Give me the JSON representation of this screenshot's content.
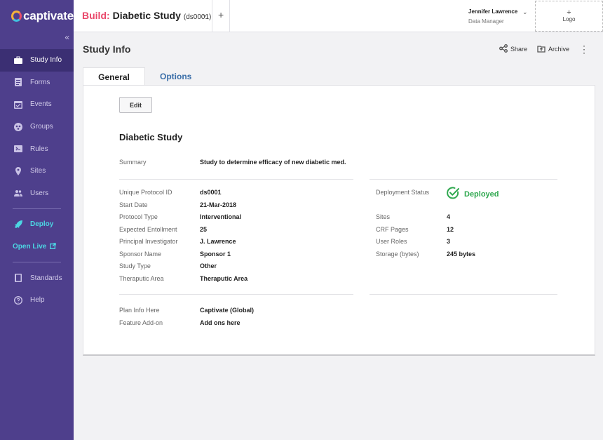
{
  "brand": {
    "name": "captivate"
  },
  "header": {
    "build_label": "Build:",
    "study_title": "Diabetic Study",
    "study_id": "(ds0001)",
    "user_name": "Jennifer Lawrence",
    "user_role": "Data Manager",
    "logo_plus": "+",
    "logo_label": "Logo"
  },
  "sidebar": {
    "collapse": "«",
    "items": [
      {
        "label": "Study Info",
        "icon": "briefcase-icon"
      },
      {
        "label": "Forms",
        "icon": "forms-icon"
      },
      {
        "label": "Events",
        "icon": "calendar-icon"
      },
      {
        "label": "Groups",
        "icon": "groups-icon"
      },
      {
        "label": "Rules",
        "icon": "rules-icon"
      },
      {
        "label": "Sites",
        "icon": "location-pin-icon"
      },
      {
        "label": "Users",
        "icon": "users-icon"
      }
    ],
    "deploy": "Deploy",
    "open_live": "Open Live",
    "standards": "Standards",
    "help": "Help"
  },
  "page": {
    "title": "Study Info",
    "share": "Share",
    "archive": "Archive",
    "tabs": [
      "General",
      "Options"
    ]
  },
  "card": {
    "edit": "Edit",
    "study_name": "Diabetic Study",
    "summary_label": "Summary",
    "summary_value": "Study to determine efficacy of new diabetic med.",
    "details": [
      {
        "label": "Unique Protocol ID",
        "value": "ds0001"
      },
      {
        "label": "Start Date",
        "value": "21-Mar-2018"
      },
      {
        "label": "Protocol Type",
        "value": "Interventional"
      },
      {
        "label": "Expected Entollment",
        "value": "25"
      },
      {
        "label": "Principal Investigator",
        "value": "J. Lawrence"
      },
      {
        "label": "Sponsor Name",
        "value": "Sponsor 1"
      },
      {
        "label": "Study Type",
        "value": "Other"
      },
      {
        "label": "Theraputic Area",
        "value": "Theraputic Area"
      }
    ],
    "deployment_label": "Deployment Status",
    "deployment_value": "Deployed",
    "deployment_color": "#2fa84f",
    "stats": [
      {
        "label": "Sites",
        "value": "4"
      },
      {
        "label": "CRF Pages",
        "value": "12"
      },
      {
        "label": "User Roles",
        "value": "3"
      },
      {
        "label": "Storage (bytes)",
        "value": "245 bytes"
      }
    ],
    "plan": [
      {
        "label": "Plan Info Here",
        "value": "Captivate (Global)"
      },
      {
        "label": "Feature Add-on",
        "value": "Add ons here"
      }
    ]
  },
  "colors": {
    "sidebar": "#4e3f8c",
    "accent": "#e9476a",
    "link": "#3a6ea8",
    "live": "#4cd6e3"
  }
}
